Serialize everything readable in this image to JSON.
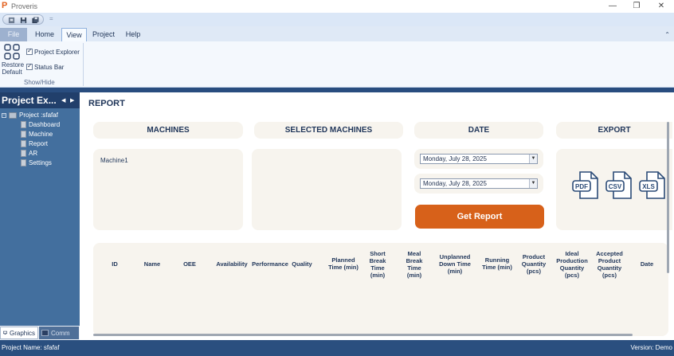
{
  "window": {
    "title": "Proveris",
    "controls": {
      "minimize": "—",
      "restore": "❐",
      "close": "✕"
    }
  },
  "qat": {
    "separator": "="
  },
  "ribbon": {
    "tabs": [
      "File",
      "Home",
      "View",
      "Project",
      "Help"
    ],
    "active_tab": "View",
    "collapse_icon": "⌃",
    "restore_default": {
      "line1": "Restore",
      "line2": "Default"
    },
    "checkboxes": [
      {
        "label": "Project Explorer",
        "checked": true
      },
      {
        "label": "Status Bar",
        "checked": true
      }
    ],
    "group_label": "Show/Hide"
  },
  "project_explorer": {
    "title": "Project Ex...",
    "nav_prev": "◀",
    "nav_next": "▶",
    "root": {
      "expander": "−",
      "label": "Project :sfafaf"
    },
    "items": [
      "Dashboard",
      "Machine",
      "Report",
      "AR",
      "Settings"
    ],
    "tabs": {
      "graphics": "Graphics",
      "comm": "Comm"
    }
  },
  "report": {
    "title": "REPORT",
    "machines": {
      "heading": "MACHINES",
      "items": [
        "Machine1"
      ]
    },
    "selected_machines": {
      "heading": "SELECTED MACHINES"
    },
    "date": {
      "heading": "DATE",
      "from": "Monday, July 28, 2025",
      "to": "Monday, July 28, 2025",
      "dropdown_glyph": "▼"
    },
    "get_report_label": "Get Report",
    "export": {
      "heading": "EXPORT",
      "formats": [
        "PDF",
        "CSV",
        "XLS"
      ]
    },
    "table": {
      "columns": [
        [
          "ID"
        ],
        [
          "Name"
        ],
        [
          "OEE"
        ],
        [
          "Availability"
        ],
        [
          "Performance"
        ],
        [
          "Quality"
        ],
        [
          "Planned",
          "Time (min)"
        ],
        [
          "Short",
          "Break",
          "Time",
          "(min)"
        ],
        [
          "Meal",
          "Break",
          "Time",
          "(min)"
        ],
        [
          "Unplanned",
          "Down Time",
          "(min)"
        ],
        [
          "Running",
          "Time (min)"
        ],
        [
          "Product",
          "Quantity",
          "(pcs)"
        ],
        [
          "Ideal",
          "Production",
          "Quantity",
          "(pcs)"
        ],
        [
          "Accepted",
          "Product",
          "Quantity",
          "(pcs)"
        ],
        [
          "Date"
        ]
      ]
    }
  },
  "statusbar": {
    "project_name": "Project Name: sfafaf",
    "version": "Version: Demo"
  },
  "colors": {
    "accent": "#d7611a",
    "panel_dark": "#213f6b",
    "panel": "#426e9e",
    "card": "#f7f4ee"
  }
}
